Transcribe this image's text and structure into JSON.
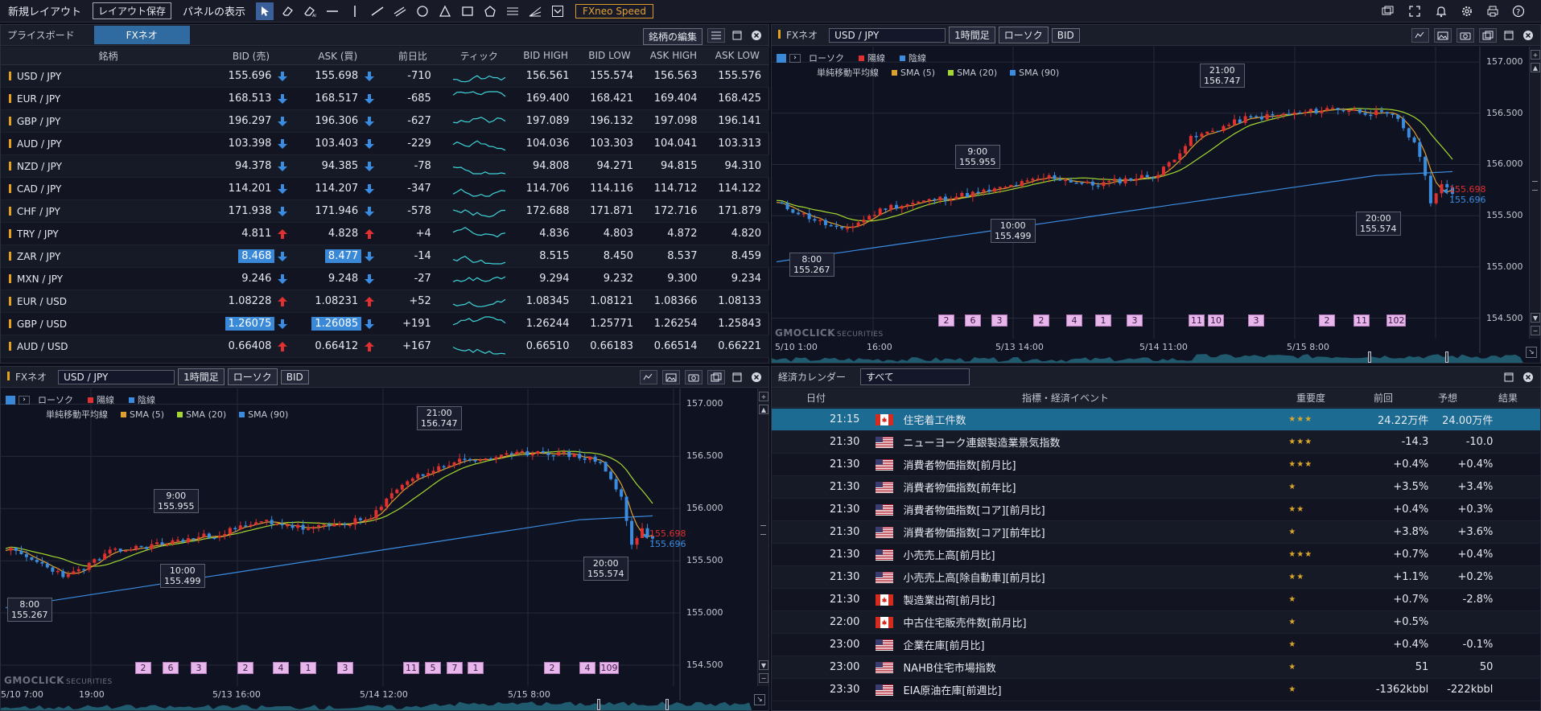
{
  "toolbar": {
    "new_layout": "新規レイアウト",
    "save_layout": "レイアウト保存",
    "panel_display": "パネルの表示",
    "speed": "FXneo Speed"
  },
  "priceboard": {
    "title": "プライスボード",
    "tab": "FXネオ",
    "edit_btn": "銘柄の編集",
    "headers": [
      "銘柄",
      "BID (売)",
      "ASK (買)",
      "前日比",
      "ティック",
      "BID HIGH",
      "BID LOW",
      "ASK HIGH",
      "ASK LOW"
    ],
    "rows": [
      {
        "pair": "USD / JPY",
        "bid": "155.696",
        "bid_dir": "down",
        "ask": "155.698",
        "ask_dir": "down",
        "chg": "-710",
        "bh": "156.561",
        "bl": "155.574",
        "ah": "156.563",
        "al": "155.576",
        "hl": false
      },
      {
        "pair": "EUR / JPY",
        "bid": "168.513",
        "bid_dir": "down",
        "ask": "168.517",
        "ask_dir": "down",
        "chg": "-685",
        "bh": "169.400",
        "bl": "168.421",
        "ah": "169.404",
        "al": "168.425",
        "hl": false
      },
      {
        "pair": "GBP / JPY",
        "bid": "196.297",
        "bid_dir": "down",
        "ask": "196.306",
        "ask_dir": "down",
        "chg": "-627",
        "bh": "197.089",
        "bl": "196.132",
        "ah": "197.098",
        "al": "196.141",
        "hl": false
      },
      {
        "pair": "AUD / JPY",
        "bid": "103.398",
        "bid_dir": "down",
        "ask": "103.403",
        "ask_dir": "down",
        "chg": "-229",
        "bh": "104.036",
        "bl": "103.303",
        "ah": "104.041",
        "al": "103.313",
        "hl": false
      },
      {
        "pair": "NZD / JPY",
        "bid": "94.378",
        "bid_dir": "down",
        "ask": "94.385",
        "ask_dir": "down",
        "chg": "-78",
        "bh": "94.808",
        "bl": "94.271",
        "ah": "94.815",
        "al": "94.310",
        "hl": false
      },
      {
        "pair": "CAD / JPY",
        "bid": "114.201",
        "bid_dir": "down",
        "ask": "114.207",
        "ask_dir": "down",
        "chg": "-347",
        "bh": "114.706",
        "bl": "114.116",
        "ah": "114.712",
        "al": "114.122",
        "hl": false
      },
      {
        "pair": "CHF / JPY",
        "bid": "171.938",
        "bid_dir": "down",
        "ask": "171.946",
        "ask_dir": "down",
        "chg": "-578",
        "bh": "172.688",
        "bl": "171.871",
        "ah": "172.716",
        "al": "171.879",
        "hl": false
      },
      {
        "pair": "TRY / JPY",
        "bid": "4.811",
        "bid_dir": "up",
        "ask": "4.828",
        "ask_dir": "up",
        "chg": "+4",
        "bh": "4.836",
        "bl": "4.803",
        "ah": "4.872",
        "al": "4.820",
        "hl": false
      },
      {
        "pair": "ZAR / JPY",
        "bid": "8.468",
        "bid_dir": "down",
        "ask": "8.477",
        "ask_dir": "down",
        "chg": "-14",
        "bh": "8.515",
        "bl": "8.450",
        "ah": "8.537",
        "al": "8.459",
        "hl": true
      },
      {
        "pair": "MXN / JPY",
        "bid": "9.246",
        "bid_dir": "down",
        "ask": "9.248",
        "ask_dir": "down",
        "chg": "-27",
        "bh": "9.294",
        "bl": "9.232",
        "ah": "9.300",
        "al": "9.234",
        "hl": false
      },
      {
        "pair": "EUR / USD",
        "bid": "1.08228",
        "bid_dir": "up",
        "ask": "1.08231",
        "ask_dir": "up",
        "chg": "+52",
        "bh": "1.08345",
        "bl": "1.08121",
        "ah": "1.08366",
        "al": "1.08133",
        "hl": false
      },
      {
        "pair": "GBP / USD",
        "bid": "1.26075",
        "bid_dir": "down",
        "ask": "1.26085",
        "ask_dir": "down",
        "chg": "+191",
        "bh": "1.26244",
        "bl": "1.25771",
        "ah": "1.26254",
        "al": "1.25843",
        "hl": true
      },
      {
        "pair": "AUD / USD",
        "bid": "0.66408",
        "bid_dir": "up",
        "ask": "0.66412",
        "ask_dir": "up",
        "chg": "+167",
        "bh": "0.66510",
        "bl": "0.66183",
        "ah": "0.66514",
        "al": "0.66221",
        "hl": false
      }
    ]
  },
  "chart_top": {
    "title": "FXネオ",
    "pair": "USD / JPY",
    "period": "1時間足",
    "type": "ローソク",
    "side": "BID",
    "legend_candle": "ローソク",
    "legend_up": "陽線",
    "legend_down": "陰線",
    "legend_ma": "単純移動平均線",
    "sma5": "SMA (5)",
    "sma20": "SMA (20)",
    "sma90": "SMA (90)",
    "yticks": [
      "157.000",
      "156.500",
      "156.000",
      "155.500",
      "155.000",
      "154.500"
    ],
    "xticks": [
      "5/10 1:00",
      "16:00",
      "5/13 14:00",
      "5/14 11:00",
      "5/15 8:00"
    ],
    "ann": [
      {
        "t": "21:00",
        "v": "156.747"
      },
      {
        "t": "9:00",
        "v": "155.955"
      },
      {
        "t": "10:00",
        "v": "155.499"
      },
      {
        "t": "8:00",
        "v": "155.267"
      },
      {
        "t": "20:00",
        "v": "155.574"
      }
    ],
    "ask_label": "155.698",
    "bid_label": "155.696",
    "events": [
      "2",
      "6",
      "3",
      "2",
      "4",
      "1",
      "3",
      "11",
      "10",
      "3",
      "2",
      "11",
      "102"
    ],
    "logo": "GMOCLICK",
    "logo_sub": "SECURITIES"
  },
  "chart_bottom": {
    "title": "FXネオ",
    "pair": "USD / JPY",
    "period": "1時間足",
    "type": "ローソク",
    "side": "BID",
    "legend_candle": "ローソク",
    "legend_up": "陽線",
    "legend_down": "陰線",
    "legend_ma": "単純移動平均線",
    "sma5": "SMA (5)",
    "sma20": "SMA (20)",
    "sma90": "SMA (90)",
    "yticks": [
      "157.000",
      "156.500",
      "156.000",
      "155.500",
      "155.000",
      "154.500"
    ],
    "xticks": [
      "5/10 7:00",
      "19:00",
      "5/13 16:00",
      "5/14 12:00",
      "5/15 8:00"
    ],
    "ann": [
      {
        "t": "21:00",
        "v": "156.747"
      },
      {
        "t": "9:00",
        "v": "155.955"
      },
      {
        "t": "10:00",
        "v": "155.499"
      },
      {
        "t": "8:00",
        "v": "155.267"
      },
      {
        "t": "20:00",
        "v": "155.574"
      }
    ],
    "ask_label": "155.698",
    "bid_label": "155.696",
    "events": [
      "2",
      "6",
      "3",
      "2",
      "4",
      "1",
      "3",
      "11",
      "5",
      "7",
      "1",
      "2",
      "4",
      "109"
    ],
    "logo": "GMOCLICK",
    "logo_sub": "SECURITIES"
  },
  "calendar": {
    "title": "経済カレンダー",
    "filter": "すべて",
    "headers": [
      "日付",
      "指標・経済イベント",
      "重要度",
      "前回",
      "予想",
      "結果"
    ],
    "rows": [
      {
        "time": "21:15",
        "flag": "ca",
        "event": "住宅着工件数",
        "imp": "★★★",
        "prev": "24.22万件",
        "fore": "24.00万件",
        "sel": true
      },
      {
        "time": "21:30",
        "flag": "us",
        "event": "ニューヨーク連銀製造業景気指数",
        "imp": "★★★",
        "prev": "-14.3",
        "fore": "-10.0",
        "sel": false
      },
      {
        "time": "21:30",
        "flag": "us",
        "event": "消費者物価指数[前月比]",
        "imp": "★★★",
        "prev": "+0.4%",
        "fore": "+0.4%",
        "sel": false
      },
      {
        "time": "21:30",
        "flag": "us",
        "event": "消費者物価指数[前年比]",
        "imp": "★",
        "prev": "+3.5%",
        "fore": "+3.4%",
        "sel": false
      },
      {
        "time": "21:30",
        "flag": "us",
        "event": "消費者物価指数[コア][前月比]",
        "imp": "★★",
        "prev": "+0.4%",
        "fore": "+0.3%",
        "sel": false
      },
      {
        "time": "21:30",
        "flag": "us",
        "event": "消費者物価指数[コア][前年比]",
        "imp": "★",
        "prev": "+3.8%",
        "fore": "+3.6%",
        "sel": false
      },
      {
        "time": "21:30",
        "flag": "us",
        "event": "小売売上高[前月比]",
        "imp": "★★★",
        "prev": "+0.7%",
        "fore": "+0.4%",
        "sel": false
      },
      {
        "time": "21:30",
        "flag": "us",
        "event": "小売売上高[除自動車][前月比]",
        "imp": "★★",
        "prev": "+1.1%",
        "fore": "+0.2%",
        "sel": false
      },
      {
        "time": "21:30",
        "flag": "ca",
        "event": "製造業出荷[前月比]",
        "imp": "★",
        "prev": "+0.7%",
        "fore": "-2.8%",
        "sel": false
      },
      {
        "time": "22:00",
        "flag": "ca",
        "event": "中古住宅販売件数[前月比]",
        "imp": "★",
        "prev": "+0.5%",
        "fore": "",
        "sel": false
      },
      {
        "time": "23:00",
        "flag": "us",
        "event": "企業在庫[前月比]",
        "imp": "★",
        "prev": "+0.4%",
        "fore": "-0.1%",
        "sel": false
      },
      {
        "time": "23:00",
        "flag": "us",
        "event": "NAHB住宅市場指数",
        "imp": "★",
        "prev": "51",
        "fore": "50",
        "sel": false
      },
      {
        "time": "23:30",
        "flag": "us",
        "event": "EIA原油在庫[前週比]",
        "imp": "★",
        "prev": "-1362kbbl",
        "fore": "-222kbbl",
        "sel": false
      }
    ]
  },
  "colors": {
    "up": "#e0302f",
    "down": "#3a8ce0",
    "sma5": "#e0a030",
    "sma20": "#a4d830",
    "sma90": "#3a8ce0",
    "accent": "#3a89d8",
    "star": "#d9a72a"
  }
}
